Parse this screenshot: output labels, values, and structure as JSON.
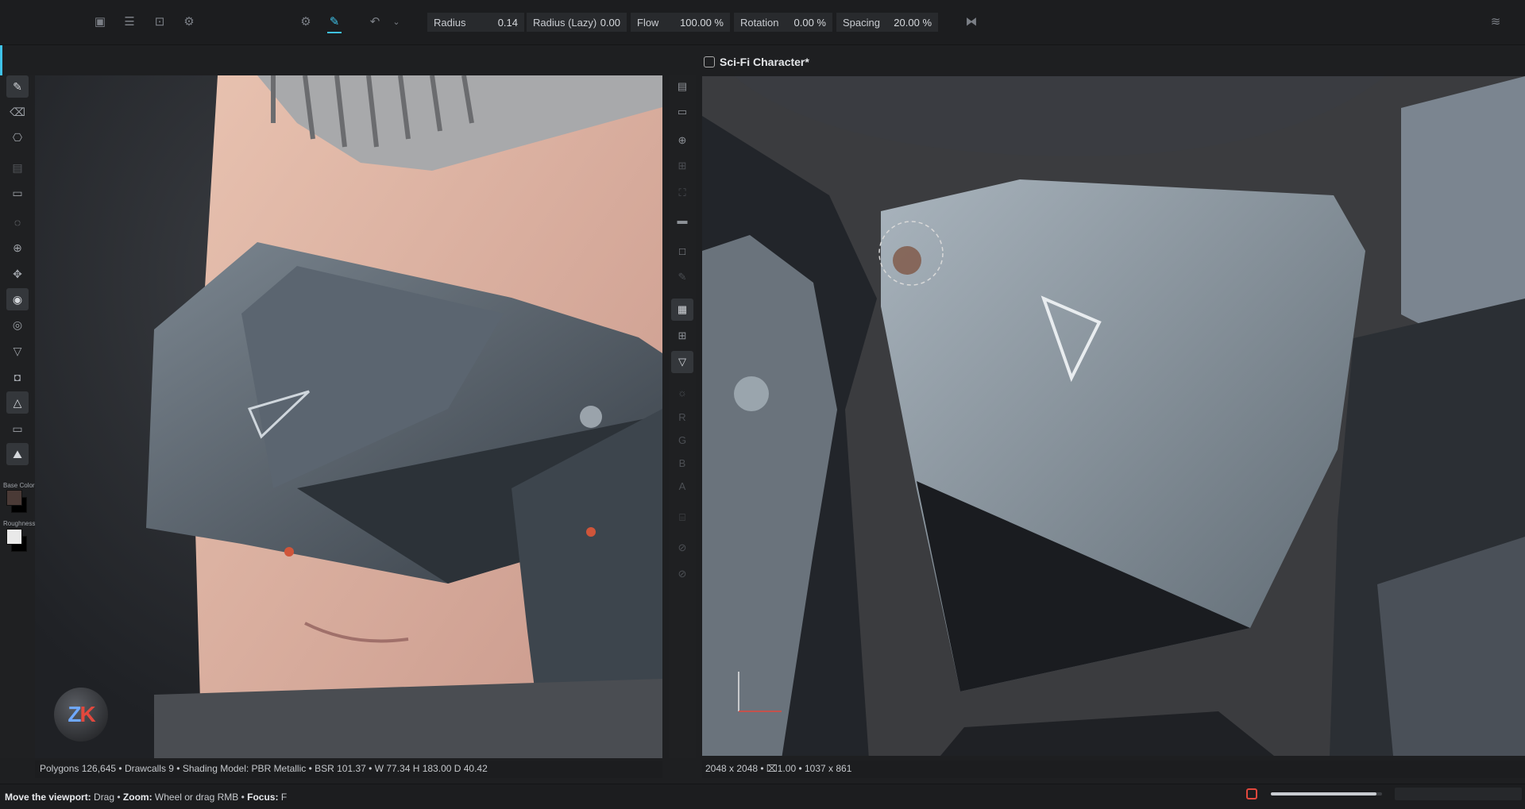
{
  "toolbar": {
    "params": [
      {
        "label": "Radius",
        "value": "0.14"
      },
      {
        "label": "Radius (Lazy)",
        "value": "0.00"
      },
      {
        "label": "Flow",
        "value": "100.00 %"
      },
      {
        "label": "Rotation",
        "value": "0.00 %"
      },
      {
        "label": "Spacing",
        "value": "20.00 %"
      }
    ]
  },
  "document": {
    "title": "Sci-Fi Character*"
  },
  "swatches": {
    "base_color_label": "Base Color",
    "base_color": "#4a3a36",
    "roughness_label": "Roughness",
    "roughness": "#e9e9e9"
  },
  "channels": [
    "R",
    "G",
    "B",
    "A"
  ],
  "status": {
    "viewport3d": "Polygons 126,645 • Drawcalls 9 • Shading Model: PBR Metallic • BSR 101.37 • W 77.34 H 183.00 D 40.42",
    "viewport2d": "2048 x 2048 • ⌧1.00 • 1037 x 861"
  },
  "hints": {
    "move_label": "Move the viewport:",
    "move_value": " Drag • ",
    "zoom_label": "Zoom:",
    "zoom_value": " Wheel or drag RMB • ",
    "focus_label": "Focus:",
    "focus_value": " F"
  },
  "logo": {
    "left": "Z",
    "right": "K"
  },
  "progress": 0.95,
  "colors": {
    "accent": "#3fc2e8",
    "record": "#e2483d"
  }
}
